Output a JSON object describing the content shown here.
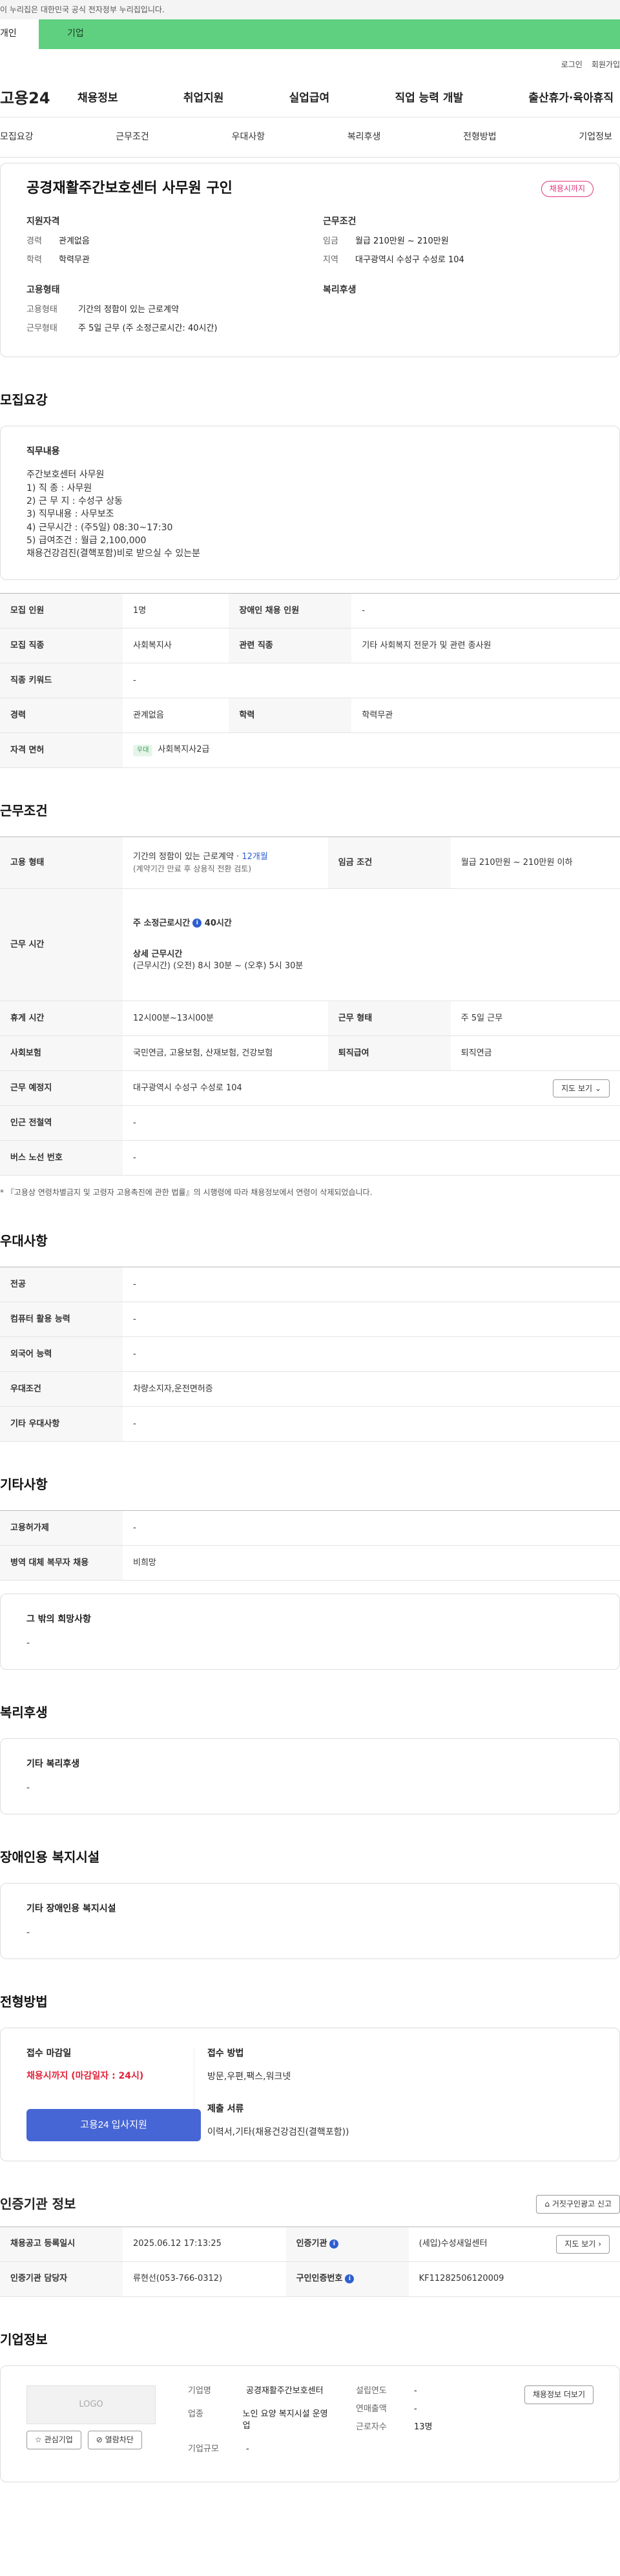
{
  "gov_banner": "이 누리집은 대한민국 공식 전자정부 누리집입니다.",
  "top_tabs": {
    "person": "개인",
    "corp": "기업"
  },
  "util": {
    "login": "로그인",
    "join": "회원가입"
  },
  "logo": "고용24",
  "gnb": [
    "채용정보",
    "취업지원",
    "실업급여",
    "직업 능력 개발",
    "출산휴가·육아휴직"
  ],
  "subnav": [
    "모집요강",
    "근무조건",
    "우대사항",
    "복리후생",
    "전형방법",
    "기업정보"
  ],
  "job": {
    "title": "공경재활주간보호센터 사무원 구인",
    "status": "채용시까지",
    "qual_h": "지원자격",
    "exp_k": "경력",
    "exp_v": "관계없음",
    "edu_k": "학력",
    "edu_v": "학력무관",
    "cond_h": "근무조건",
    "wage_k": "임금",
    "wage_v": "월급 210만원 ~ 210만원",
    "area_k": "지역",
    "area_v": "대구광역시 수성구 수성로 104",
    "emp_h": "고용형태",
    "emp_type_k": "고용형태",
    "emp_type_v": "기간의 정함이 있는 근로계약",
    "work_form_k": "근무형태",
    "work_form_v": "주 5일 근무 (주 소정근로시간: 40시간)",
    "welfare_h": "복리후생"
  },
  "recruit": {
    "title": "모집요강",
    "duty_h": "직무내용",
    "duty_text": "주간보호센터 사무원\n1) 직 종 : 사무원\n2) 근 무 지 : 수성구 상동\n3) 직무내용 : 사무보조\n4) 근무시간 : (주5일) 08:30~17:30\n5) 급여조건 : 월급 2,100,000\n채용건강검진(결핵포함)비로 받으실 수 있는분",
    "headcount_k": "모집 인원",
    "headcount_v": "1명",
    "disabled_k": "장애인 채용 인원",
    "disabled_v": "-",
    "job_k": "모집 직종",
    "job_v": "사회복지사",
    "related_k": "관련 직종",
    "related_v": "기타 사회복지 전문가 및 관련 종사원",
    "keyword_k": "직종 키워드",
    "keyword_v": "-",
    "career_k": "경력",
    "career_v": "관계없음",
    "edu_k": "학력",
    "edu_v": "학력무관",
    "license_k": "자격 면허",
    "license_tag": "우대",
    "license_v": "사회복지사2급"
  },
  "work": {
    "title": "근무조건",
    "emp_k": "고용 형태",
    "emp_v1": "기간의 정함이 있는 근로계약 · ",
    "emp_months": "12개월",
    "emp_v2": "(계약기간 만료 후 상용직 전환 검토)",
    "wage_k": "임금 조건",
    "wage_v": "월급 210만원 ~ 210만원 이하",
    "time_k": "근무 시간",
    "time_h1": "주 소정근로시간",
    "time_v1": "40시간",
    "time_h2": "상세 근무시간",
    "time_v2": "(근무시간) (오전) 8시 30분 ~ (오후) 5시 30분",
    "break_k": "휴게 시간",
    "break_v": "12시00분~13시00분",
    "form_k": "근무 형태",
    "form_v": "주 5일 근무",
    "ins_k": "사회보험",
    "ins_v": "국민연금, 고용보험, 산재보험, 건강보험",
    "retire_k": "퇴직급여",
    "retire_v": "퇴직연금",
    "place_k": "근무 예정지",
    "place_v": "대구광역시 수성구 수성로 104",
    "map_btn": "지도 보기",
    "subway_k": "인근 전철역",
    "subway_v": "-",
    "bus_k": "버스 노선 번호",
    "bus_v": "-",
    "note": "* 『고용상 연령차별금지 및 고령자 고용촉진에 관한 법률』의 시행령에 따라 채용정보에서 연령이 삭제되었습니다."
  },
  "pref": {
    "title": "우대사항",
    "major_k": "전공",
    "major_v": "-",
    "pc_k": "컴퓨터 활용 능력",
    "pc_v": "-",
    "lang_k": "외국어 능력",
    "lang_v": "-",
    "cond_k": "우대조건",
    "cond_v": "차량소지자,운전면허증",
    "etc_k": "기타 우대사항",
    "etc_v": "-"
  },
  "other": {
    "title": "기타사항",
    "disabled_k": "고용허가제",
    "disabled_v": "-",
    "military_k": "병역 대체 복무자 채용",
    "military_v": "비희망",
    "wish_h": "그 밖의 희망사항",
    "wish_v": "-"
  },
  "welfare": {
    "title": "복리후생",
    "h": "기타 복리후생",
    "v": "-"
  },
  "facility": {
    "title": "장애인용 복지시설",
    "h": "기타 장애인용 복지시설",
    "v": "-"
  },
  "selection": {
    "title": "전형방법",
    "deadline_h": "접수 마감일",
    "deadline_v": "채용시까지 (마감일자 : 24시)",
    "method_h": "접수 방법",
    "method_v": "방문,우편,팩스,워크넷",
    "docs_h": "제출 서류",
    "docs_v": "이력서,기타(채용건강검진(결핵포함))",
    "apply_btn": "고용24 입사지원"
  },
  "cert": {
    "title": "인증기관 정보",
    "report_btn": "거짓구인광고 신고",
    "reg_k": "채용공고 등록일시",
    "reg_v": "2025.06.12 17:13:25",
    "org_k": "인증기관",
    "org_v": "(세입)수성새일센터",
    "map_btn": "지도 보기",
    "mgr_k": "인증기관 담당자",
    "mgr_v": "류현선(053-766-0312)",
    "num_k": "구인인증번호",
    "num_v": "KF11282506120009"
  },
  "corp": {
    "title": "기업정보",
    "logo": "LOGO",
    "fav_btn": "관심기업",
    "block_btn": "열람차단",
    "info_btn": "채용정보 더보기",
    "name_k": "기업명",
    "name_v": "공경재활주간보호센터",
    "biz_k": "업종",
    "biz_v": "노인 요양 복지시설 운영업",
    "size_k": "기업규모",
    "size_v": "-",
    "year_k": "설립연도",
    "year_v": "-",
    "sales_k": "연매출액",
    "sales_v": "-",
    "emp_k": "근로자수",
    "emp_v": "13명"
  }
}
